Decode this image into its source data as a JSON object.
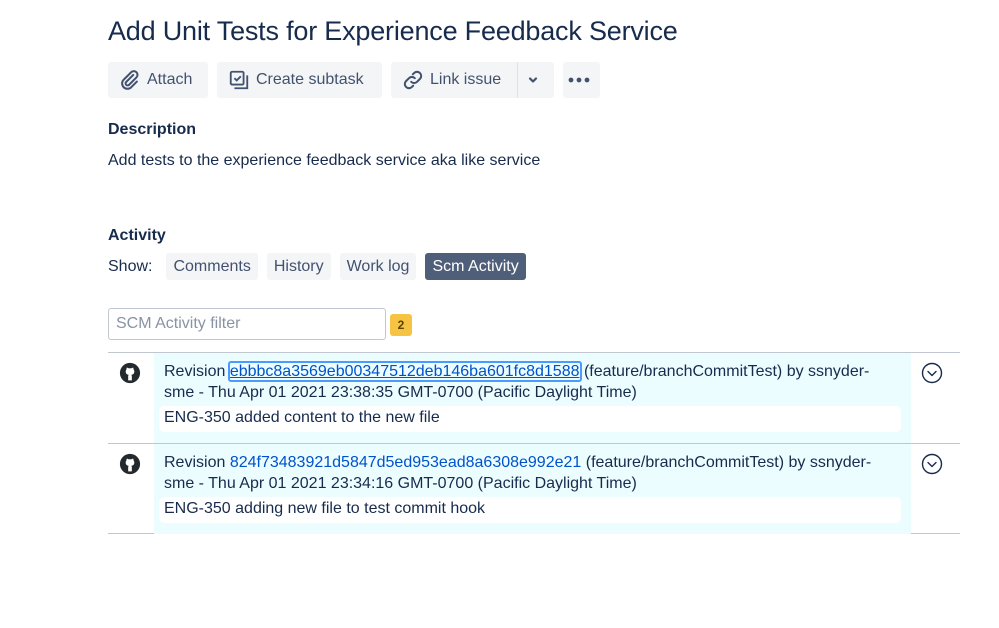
{
  "issue": {
    "title": "Add Unit Tests for Experience Feedback Service"
  },
  "toolbar": {
    "attach_label": "Attach",
    "create_subtask_label": "Create subtask",
    "link_issue_label": "Link issue"
  },
  "description": {
    "label": "Description",
    "text": "Add tests to the experience feedback service aka like service"
  },
  "activity": {
    "label": "Activity",
    "show_label": "Show:",
    "tabs": [
      {
        "label": "Comments",
        "active": false
      },
      {
        "label": "History",
        "active": false
      },
      {
        "label": "Work log",
        "active": false
      },
      {
        "label": "Scm Activity",
        "active": true
      }
    ],
    "filter_placeholder": "SCM Activity filter",
    "filter_value": "",
    "count": "2",
    "count_color": "#f6c342",
    "active_tab_color": "#505f79",
    "entries": [
      {
        "icon": "github-icon",
        "revision_prefix": "Revision",
        "revision": "ebbbc8a3569eb00347512deb146ba601fc8d1588",
        "details": "(feature/branchCommitTest) by ssnyder-sme - Thu Apr 01 2021 23:38:35 GMT-0700 (Pacific Daylight Time)",
        "message": "ENG-350 added content to the new file",
        "focused": true
      },
      {
        "icon": "github-icon",
        "revision_prefix": "Revision",
        "revision": "824f73483921d5847d5ed953ead8a6308e992e21",
        "details": "(feature/branchCommitTest) by ssnyder-sme - Thu Apr 01 2021 23:34:16 GMT-0700 (Pacific Daylight Time)",
        "message": "ENG-350 adding new file to test commit hook",
        "focused": false
      }
    ]
  }
}
